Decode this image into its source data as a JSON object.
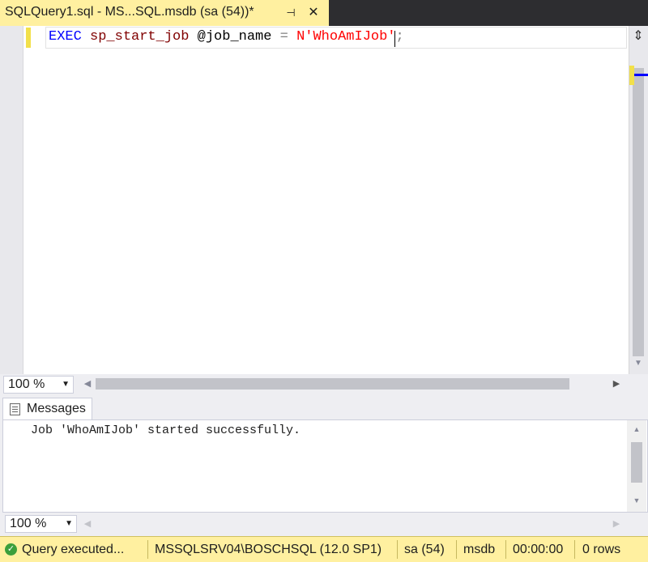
{
  "tab": {
    "title": "SQLQuery1.sql - MS...SQL.msdb (sa (54))*",
    "pin_glyph": "⊣",
    "close_glyph": "✕"
  },
  "editor": {
    "code": {
      "keyword": "EXEC",
      "procedure": "sp_start_job",
      "parameter": "@job_name",
      "operator": "=",
      "string": "N'WhoAmIJob'",
      "terminator": ";"
    },
    "zoom": "100 %"
  },
  "messages": {
    "tab_label": "Messages",
    "text": "Job 'WhoAmIJob' started successfully.",
    "zoom": "100 %"
  },
  "statusbar": {
    "status": "Query  executed...",
    "server": "MSSQLSRV04\\BOSCHSQL (12.0 SP1)",
    "user": "sa (54)",
    "database": "msdb",
    "elapsed": "00:00:00",
    "rows": "0 rows"
  },
  "colors": {
    "tab_active": "#fff0a0",
    "tab_bar": "#2d2d30",
    "keyword": "#0000ff",
    "procedure": "#800000",
    "string": "#ff0000",
    "status_ok": "#3c9f3c"
  },
  "icons": [
    "pin-icon",
    "close-icon",
    "split-window-icon",
    "messages-icon",
    "success-check-icon"
  ]
}
